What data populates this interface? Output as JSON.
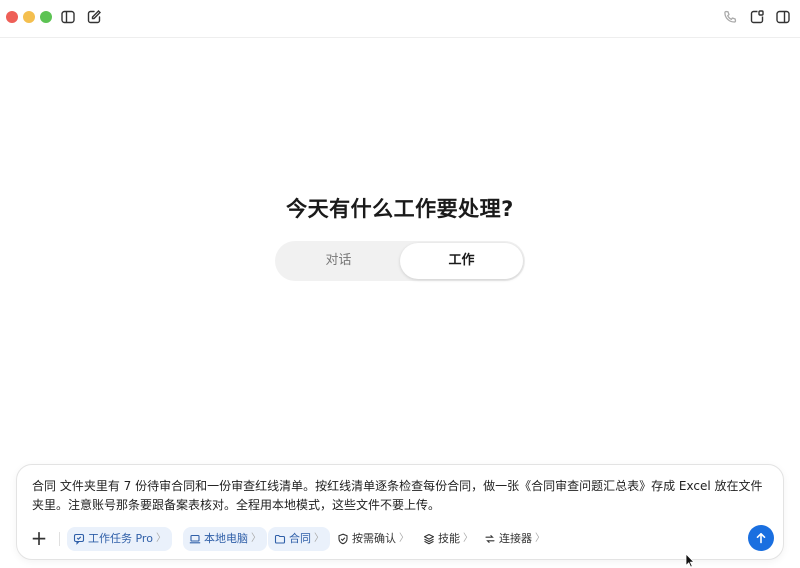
{
  "headline": "今天有什么工作要处理?",
  "mode_toggle": {
    "chat_label": "对话",
    "work_label": "工作",
    "selected": "工作"
  },
  "composer": {
    "prompt_text": "合同 文件夹里有 7 份待审合同和一份审查红线清单。按红线清单逐条检查每份合同，做一张《合同审查问题汇总表》存成 Excel 放在文件夹里。注意账号那条要跟备案表核对。全程用本地模式，这些文件不要上传。",
    "chips": {
      "task_mode": "工作任务 Pro",
      "location": "本地电脑",
      "folder": "合同",
      "confirm": "按需确认",
      "skills": "技能",
      "connectors": "连接器"
    },
    "chevron": "〉"
  },
  "icons": {
    "sidebar": "sidebar-toggle-icon",
    "new_chat": "compose-icon",
    "phone": "phone-icon",
    "new_window": "new-window-icon",
    "right_panel": "right-panel-icon",
    "send": "arrow-up-icon"
  },
  "colors": {
    "accent": "#1a6fe0",
    "chip_bg": "#eaf1fb",
    "chip_text": "#2f5fa8"
  }
}
